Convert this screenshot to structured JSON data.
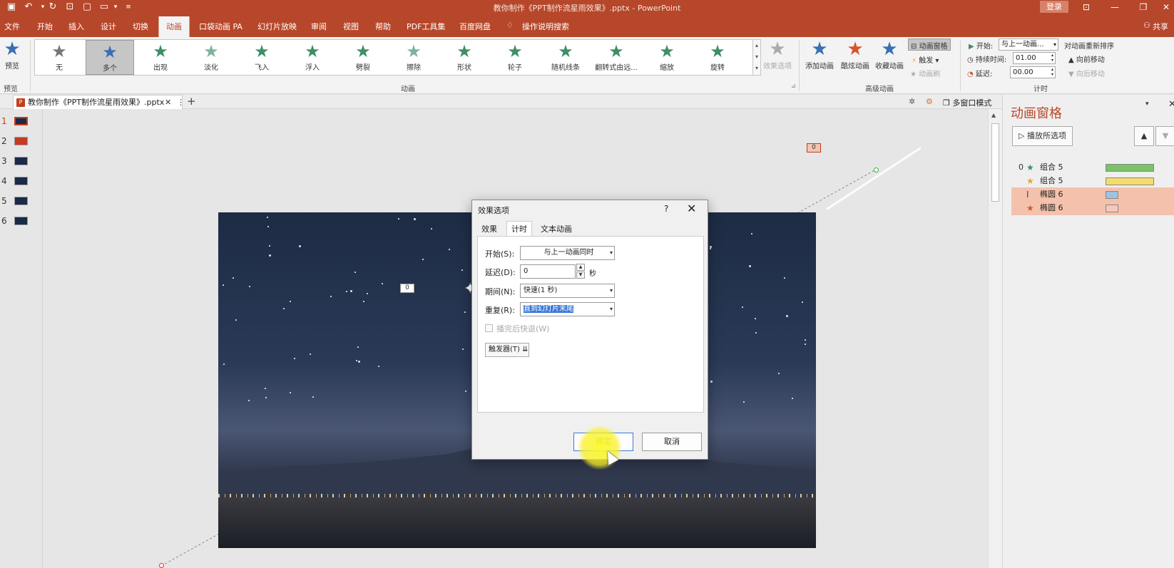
{
  "window": {
    "title": "教你制作《PPT制作流星雨效果》.pptx - PowerPoint",
    "login": "登录",
    "share": "共享"
  },
  "ribbon_tabs": [
    "文件",
    "开始",
    "插入",
    "设计",
    "切换",
    "动画",
    "口袋动画 PA",
    "幻灯片放映",
    "审阅",
    "视图",
    "帮助",
    "PDF工具集",
    "百度网盘"
  ],
  "active_tab": "动画",
  "search_hint": "操作说明搜索",
  "preview": {
    "label": "预览",
    "group": "预览"
  },
  "gallery": {
    "items": [
      {
        "label": "无",
        "color": "#777777"
      },
      {
        "label": "多个",
        "color": "#3b6fb3"
      },
      {
        "label": "出现",
        "color": "#3e8e66"
      },
      {
        "label": "淡化",
        "color": "#7cb39a"
      },
      {
        "label": "飞入",
        "color": "#3e8e66"
      },
      {
        "label": "浮入",
        "color": "#3e8e66"
      },
      {
        "label": "劈裂",
        "color": "#3e8e66"
      },
      {
        "label": "擦除",
        "color": "#7cb39a"
      },
      {
        "label": "形状",
        "color": "#3e8e66"
      },
      {
        "label": "轮子",
        "color": "#3e8e66"
      },
      {
        "label": "随机线条",
        "color": "#3e8e66"
      },
      {
        "label": "翻转式由远...",
        "color": "#3e8e66"
      },
      {
        "label": "缩放",
        "color": "#3e8e66"
      },
      {
        "label": "旋转",
        "color": "#3e8e66"
      }
    ],
    "selected": 1,
    "group": "动画",
    "effect_options": "效果选项"
  },
  "advanced": {
    "add": "添加动画",
    "cool": "酷炫动画",
    "collect": "收藏动画",
    "pane": "动画窗格",
    "trigger": "触发",
    "brush": "动画刷",
    "group": "高级动画"
  },
  "timing": {
    "start_label": "开始:",
    "start_value": "与上一动画...",
    "duration_label": "持续时间:",
    "duration_value": "01.00",
    "delay_label": "延迟:",
    "delay_value": "00.00",
    "reorder": "对动画重新排序",
    "forward": "向前移动",
    "backward": "向后移动",
    "group": "计时"
  },
  "doc_tab": {
    "name": "教你制作《PPT制作流星雨效果》.pptx",
    "multiwin": "多窗口模式"
  },
  "thumbs": [
    "1",
    "2",
    "3",
    "4",
    "5",
    "6"
  ],
  "slide_tags": {
    "tag_a": "0",
    "tag_b": "0"
  },
  "anim_pane": {
    "title": "动画窗格",
    "play": "播放所选项",
    "items": [
      {
        "num": "0",
        "name": "组合 5",
        "icon_color": "#3e8e66",
        "bar_color": "#7ac368",
        "bar_frac": 0.45,
        "hl": false
      },
      {
        "num": "",
        "name": "组合 5",
        "icon_color": "#e3a43e",
        "bar_color": "#f5dc6e",
        "bar_frac": 0.45,
        "hl": false
      },
      {
        "num": "",
        "name": "椭圆 6",
        "icon_color": "#444444",
        "bar_color": "#9cc3df",
        "bar_frac": 0.12,
        "hl": true
      },
      {
        "num": "",
        "name": "椭圆 6",
        "icon_color": "#d9542b",
        "bar_color": "#f7c7bd",
        "bar_frac": 0.12,
        "hl": true
      }
    ]
  },
  "dialog": {
    "title": "效果选项",
    "help": "?",
    "tabs": [
      "效果",
      "计时",
      "文本动画"
    ],
    "active_tab": 1,
    "start_label": "开始(S):",
    "start_value": "与上一动画同时",
    "delay_label": "延迟(D):",
    "delay_value": "0",
    "delay_unit": "秒",
    "period_label": "期间(N):",
    "period_value": "快速(1 秒)",
    "repeat_label": "重复(R):",
    "repeat_value": "直到幻灯片末尾",
    "rewind_label": "播完后快退(W)",
    "trigger_label": "触发器(T)",
    "ok": "确定",
    "cancel": "取消"
  }
}
